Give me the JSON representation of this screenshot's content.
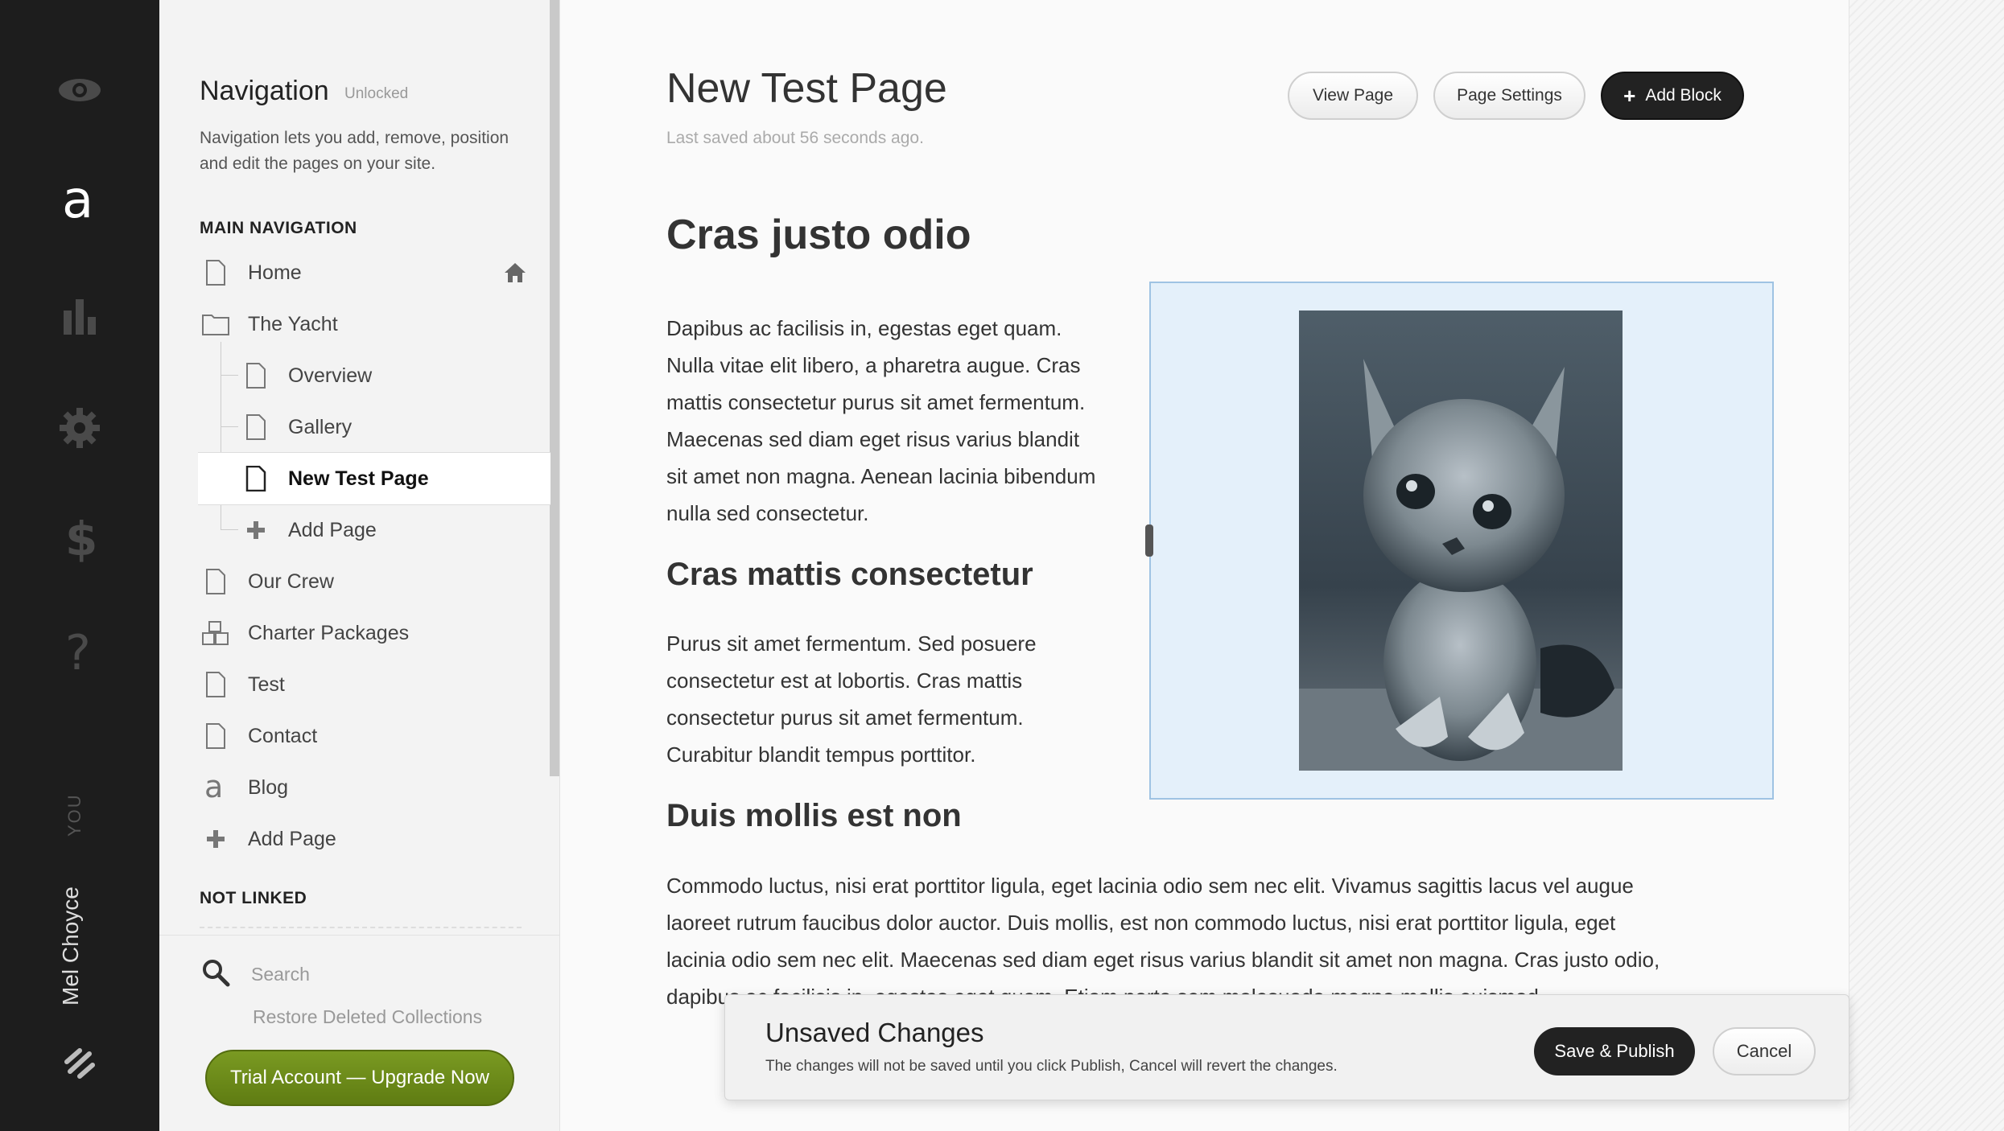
{
  "rail": {
    "icons": [
      "eye-icon",
      "logo-a-icon",
      "analytics-icon",
      "gear-icon",
      "dollar-icon",
      "help-icon",
      "squarespace-logo-icon"
    ],
    "you_label": "YOU",
    "user_name": "Mel Choyce"
  },
  "nav": {
    "title": "Navigation",
    "lock_status": "Unlocked",
    "description": "Navigation lets you add, remove, position and edit the pages on your site.",
    "main_label": "MAIN NAVIGATION",
    "not_linked_label": "NOT LINKED",
    "items": [
      {
        "label": "Home",
        "icon": "page-icon"
      },
      {
        "label": "The Yacht",
        "icon": "folder-icon"
      },
      {
        "label": "Overview",
        "icon": "page-icon"
      },
      {
        "label": "Gallery",
        "icon": "page-icon"
      },
      {
        "label": "New Test Page",
        "icon": "page-icon"
      },
      {
        "label": "Add Page",
        "icon": "plus-icon"
      },
      {
        "label": "Our Crew",
        "icon": "page-icon"
      },
      {
        "label": "Charter Packages",
        "icon": "blocks-icon"
      },
      {
        "label": "Test",
        "icon": "page-icon"
      },
      {
        "label": "Contact",
        "icon": "page-icon"
      },
      {
        "label": "Blog",
        "icon": "blog-icon"
      },
      {
        "label": "Add Page",
        "icon": "plus-icon"
      }
    ],
    "search_placeholder": "Search",
    "restore_label": "Restore Deleted Collections",
    "upgrade_label": "Trial Account — Upgrade Now"
  },
  "page": {
    "title": "New Test Page",
    "saved_text": "Last saved about 56 seconds ago.",
    "view_page": "View Page",
    "page_settings": "Page Settings",
    "add_block": "Add Block",
    "heading1": "Cras justo odio",
    "para1": [
      "Dapibus ac facilisis in, egestas eget quam.",
      "Nulla vitae elit libero, a pharetra augue. Cras",
      "mattis consectetur purus sit amet fermentum.",
      "Maecenas sed diam eget risus varius blandit",
      "sit amet non magna. Aenean lacinia bibendum",
      "nulla sed consectetur."
    ],
    "heading2": "Cras mattis consectetur",
    "para2": [
      "Purus sit amet fermentum. Sed posuere",
      "consectetur est at lobortis. Cras mattis",
      "consectetur purus sit amet fermentum.",
      "Curabitur blandit tempus porttitor."
    ],
    "heading3": "Duis mollis est non",
    "para3": [
      "Commodo luctus, nisi erat porttitor ligula, eget lacinia odio sem nec elit. Vivamus sagittis lacus vel augue",
      "laoreet rutrum faucibus dolor auctor. Duis mollis, est non commodo luctus, nisi erat porttitor ligula, eget",
      "lacinia odio sem nec elit. Maecenas sed diam eget risus varius blandit sit amet non magna. Cras justo odio,",
      "dapibus ac facilisis in, egestas eget quam. Etiam porta sem malesuada magna mollis euismod."
    ]
  },
  "unsaved": {
    "title": "Unsaved Changes",
    "description": "The changes will not be saved until you click Publish, Cancel will revert the changes.",
    "save_label": "Save & Publish",
    "cancel_label": "Cancel"
  },
  "colors": {
    "rail": "#1d1d1d",
    "upgrade_green": "#6b8a19",
    "image_block_bg": "#e4f0fa",
    "image_block_border": "#9fc3e3"
  }
}
